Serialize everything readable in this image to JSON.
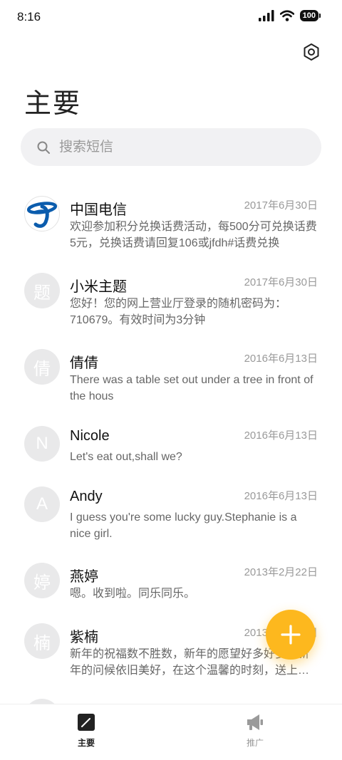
{
  "status_bar": {
    "time": "8:16",
    "battery": "100"
  },
  "header": {
    "title": "主要"
  },
  "search": {
    "placeholder": "搜索短信"
  },
  "messages": [
    {
      "avatar": "",
      "name": "中国电信",
      "date": "2017年6月30日",
      "preview": "欢迎参加积分兑换话费活动，每500分可兑换话费5元，兑换话费请回复106或jfdh#话费兑换"
    },
    {
      "avatar": "题",
      "name": "小米主题",
      "date": "2017年6月30日",
      "preview": "您好！您的网上营业厅登录的随机密码为：710679。有效时间为3分钟"
    },
    {
      "avatar": "倩",
      "name": "倩倩",
      "date": "2016年6月13日",
      "preview": "There was a table set out under a tree in front of the hous"
    },
    {
      "avatar": "N",
      "name": "Nicole",
      "date": "2016年6月13日",
      "preview": "Let's eat out,shall we?"
    },
    {
      "avatar": "A",
      "name": "Andy",
      "date": "2016年6月13日",
      "preview": "I guess you're some lucky guy.Stephanie is a nice girl."
    },
    {
      "avatar": "婷",
      "name": "燕婷",
      "date": "2013年2月22日",
      "preview": "嗯。收到啦。同乐同乐。"
    },
    {
      "avatar": "楠",
      "name": "紫楠",
      "date": "2013年2月22日",
      "preview": "新年的祝福数不胜数，新年的愿望好多好多，新年的问候依旧美好，在这个温馨的时刻，送上我最真挚的祝福"
    }
  ],
  "bottom_nav": {
    "main_label": "主要",
    "promo_label": "推广"
  },
  "colors": {
    "accent": "#fdb81e",
    "telecom_blue": "#0b5cad"
  }
}
